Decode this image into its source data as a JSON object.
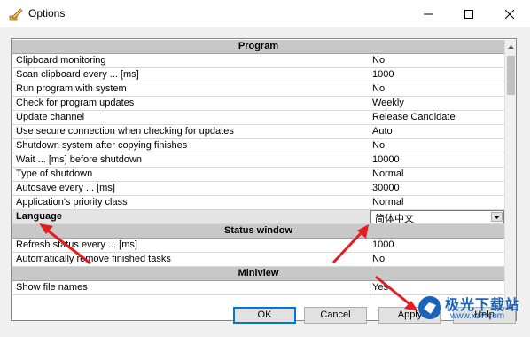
{
  "window": {
    "title": "Options",
    "icon": "pencil-app-icon"
  },
  "titlebar_buttons": {
    "minimize": "minimize-icon",
    "maximize": "maximize-icon",
    "close": "close-icon"
  },
  "grid": {
    "rows": [
      {
        "type": "section",
        "name": "Program"
      },
      {
        "type": "item",
        "name": "Clipboard monitoring",
        "value": "No"
      },
      {
        "type": "item",
        "name": "Scan clipboard every ... [ms]",
        "value": "1000"
      },
      {
        "type": "item",
        "name": "Run program with system",
        "value": "No"
      },
      {
        "type": "item",
        "name": "Check for program updates",
        "value": "Weekly"
      },
      {
        "type": "item",
        "name": "Update channel",
        "value": "Release Candidate"
      },
      {
        "type": "item",
        "name": "Use secure connection when checking for updates",
        "value": "Auto"
      },
      {
        "type": "item",
        "name": "Shutdown system after copying finishes",
        "value": "No"
      },
      {
        "type": "item",
        "name": "Wait ... [ms] before shutdown",
        "value": "10000"
      },
      {
        "type": "item",
        "name": "Type of shutdown",
        "value": "Normal"
      },
      {
        "type": "item",
        "name": "Autosave every ... [ms]",
        "value": "30000"
      },
      {
        "type": "item",
        "name": "Application's priority class",
        "value": "Normal"
      },
      {
        "type": "dropdown",
        "name": "Language",
        "value": "简体中文"
      },
      {
        "type": "section",
        "name": "Status window"
      },
      {
        "type": "item",
        "name": "Refresh status every ... [ms]",
        "value": "1000"
      },
      {
        "type": "item",
        "name": "Automatically remove finished tasks",
        "value": "No"
      },
      {
        "type": "section",
        "name": "Miniview"
      },
      {
        "type": "item",
        "name": "Show file names",
        "value": "Yes"
      }
    ]
  },
  "buttons": {
    "ok": "OK",
    "cancel": "Cancel",
    "apply": "Apply",
    "help": "Help"
  },
  "watermark": {
    "text": "极光下载站",
    "url": "www.xz7.com"
  },
  "colors": {
    "section_bg": "#c8c8c8",
    "accent": "#0078d7",
    "annotation_arrow": "#e02020",
    "watermark_blue": "#1a63b8"
  }
}
